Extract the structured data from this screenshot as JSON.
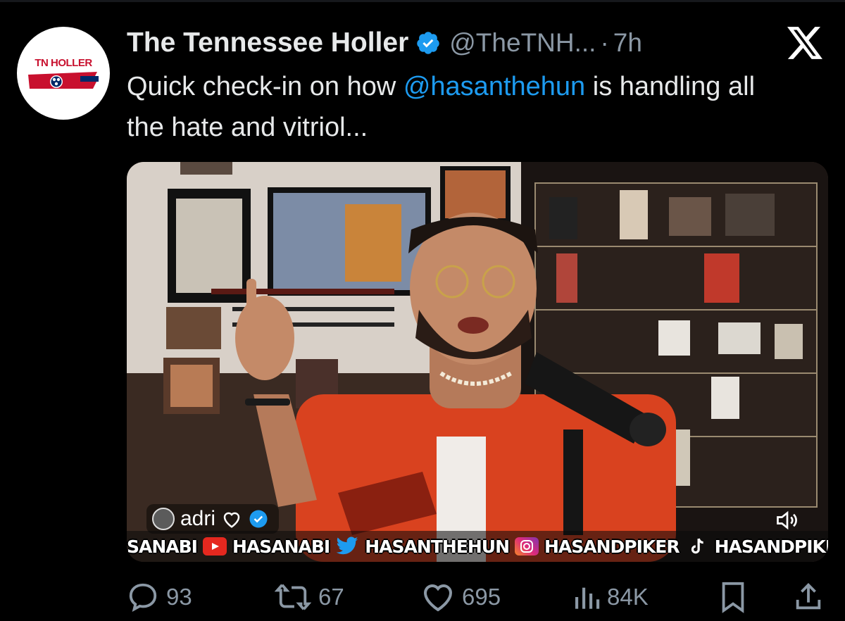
{
  "tweet": {
    "author": {
      "display_name": "The Tennessee Holler",
      "handle": "@TheTNH...",
      "separator": "·",
      "time": "7h",
      "avatar_text": "TN HOLLER",
      "verified_color": "#1d9bf0"
    },
    "text_before": "Quick check-in on how ",
    "mention": "@hasanthehun",
    "text_after": " is handling all the hate and vitriol..."
  },
  "media": {
    "overlay_user": "adri",
    "banner": [
      "SANABI",
      "HASANABI",
      "HASANTHEHUN",
      "HASANDPIKER",
      "HASANDPIKER"
    ]
  },
  "actions": {
    "replies": "93",
    "reposts": "67",
    "likes": "695",
    "views": "84K"
  },
  "colors": {
    "accent": "#1d9bf0",
    "muted": "#8b98a5",
    "background": "#000000"
  },
  "icons": [
    "x-logo-icon",
    "verified-badge-icon",
    "reply-icon",
    "repost-icon",
    "like-icon",
    "views-icon",
    "bookmark-icon",
    "share-icon",
    "sound-icon"
  ]
}
